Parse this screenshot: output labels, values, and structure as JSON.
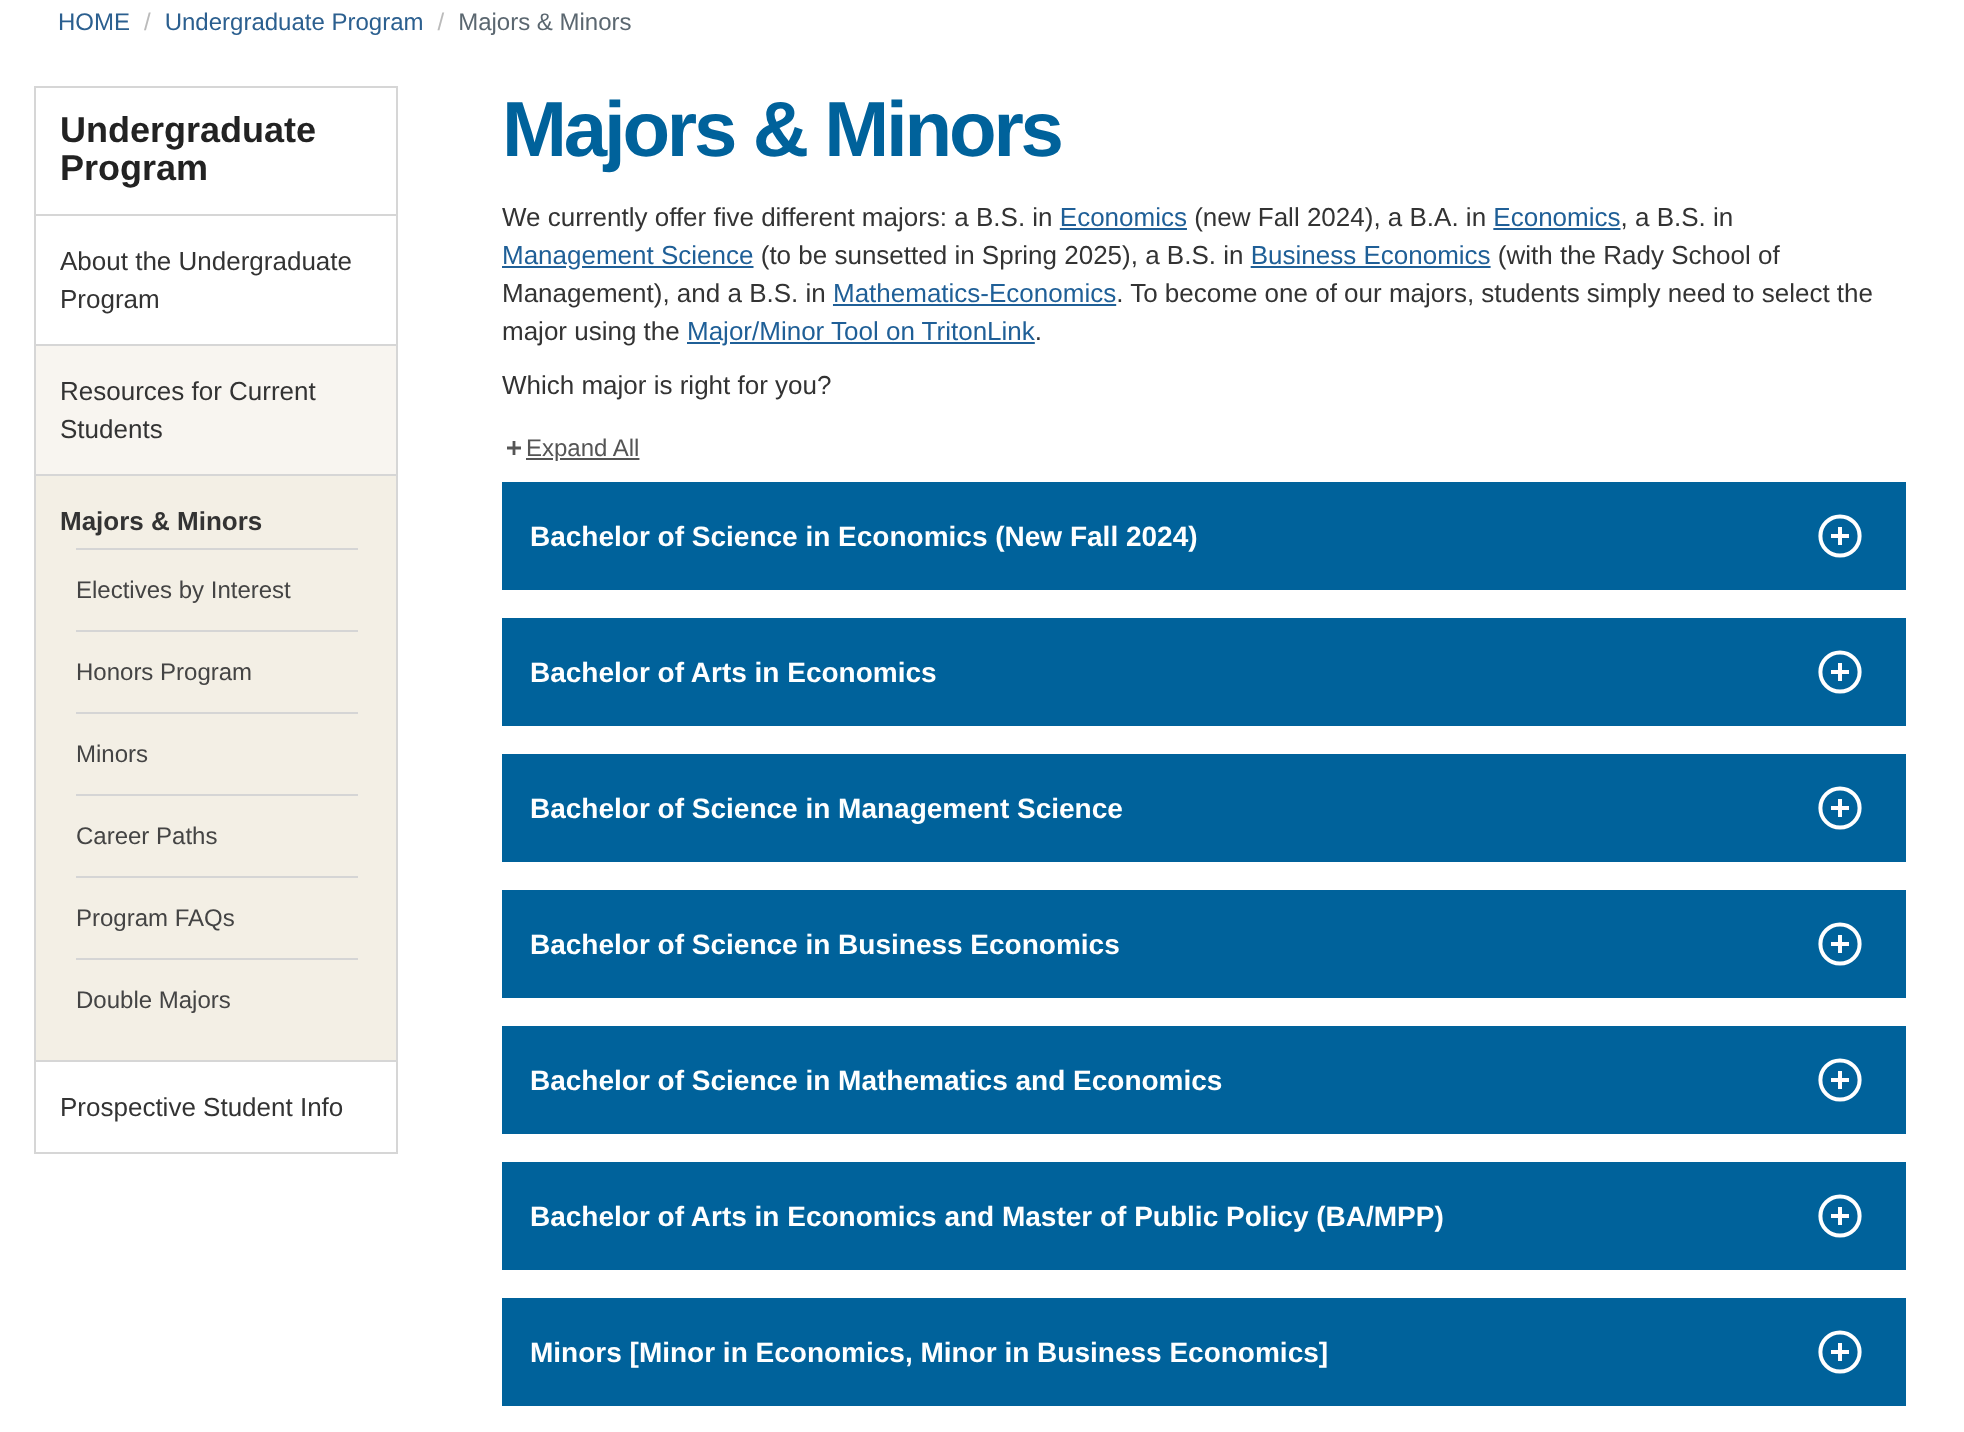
{
  "breadcrumb": [
    {
      "kind": "link",
      "text": "HOME"
    },
    {
      "kind": "separator",
      "text": "/"
    },
    {
      "kind": "link",
      "text": "Undergraduate Program"
    },
    {
      "kind": "separator",
      "text": "/"
    },
    {
      "kind": "current",
      "text": "Majors & Minors"
    }
  ],
  "sidebar": {
    "title": "Undergraduate Program",
    "items": [
      {
        "label": "About the Undergraduate Program",
        "selected": false,
        "hovered": false
      },
      {
        "label": "Resources for Current Students",
        "selected": false,
        "hovered": true
      },
      {
        "label": "Majors & Minors",
        "selected": true,
        "hovered": false,
        "children": [
          {
            "label": "Electives by Interest",
            "selected": false
          },
          {
            "label": "Honors Program",
            "selected": false
          },
          {
            "label": "Minors",
            "selected": false
          },
          {
            "label": "Career Paths",
            "selected": false
          },
          {
            "label": "Program FAQs",
            "selected": false
          },
          {
            "label": "Double Majors",
            "selected": false
          }
        ]
      },
      {
        "label": "Prospective Student Info",
        "selected": false,
        "hovered": false
      }
    ]
  },
  "main": {
    "title": "Majors & Minors",
    "intro": [
      {
        "kind": "text",
        "text": "We currently offer five different majors: a B.S. in "
      },
      {
        "kind": "link",
        "text": "Economics"
      },
      {
        "kind": "text",
        "text": " (new Fall 2024), a B.A. in "
      },
      {
        "kind": "link",
        "text": "Economics"
      },
      {
        "kind": "text",
        "text": ", a B.S. in "
      },
      {
        "kind": "link",
        "text": "Management Science"
      },
      {
        "kind": "text",
        "text": " (to be sunsetted in Spring 2025), a B.S. in "
      },
      {
        "kind": "link",
        "text": "Business Economics"
      },
      {
        "kind": "text",
        "text": " (with the Rady School of Management), and a B.S. in "
      },
      {
        "kind": "link",
        "text": "Mathematics-Economics"
      },
      {
        "kind": "text",
        "text": ". To become one of our majors, students simply need to select the major using the "
      },
      {
        "kind": "link",
        "text": "Major/Minor Tool on TritonLink"
      },
      {
        "kind": "text",
        "text": "."
      }
    ],
    "question": "Which major is right for you?",
    "expand_all": "Expand All",
    "accordions": [
      {
        "title": "Bachelor of Science in Economics (New Fall 2024)",
        "expanded": false
      },
      {
        "title": "Bachelor of Arts in Economics",
        "expanded": false
      },
      {
        "title": "Bachelor of Science in Management Science",
        "expanded": false
      },
      {
        "title": "Bachelor of Science in Business Economics",
        "expanded": false
      },
      {
        "title": "Bachelor of Science in Mathematics and Economics",
        "expanded": false
      },
      {
        "title": "Bachelor of Arts in Economics and Master of Public Policy (BA/MPP)",
        "expanded": false
      },
      {
        "title": "Minors [Minor in Economics, Minor in Business Economics]",
        "expanded": false
      }
    ]
  }
}
